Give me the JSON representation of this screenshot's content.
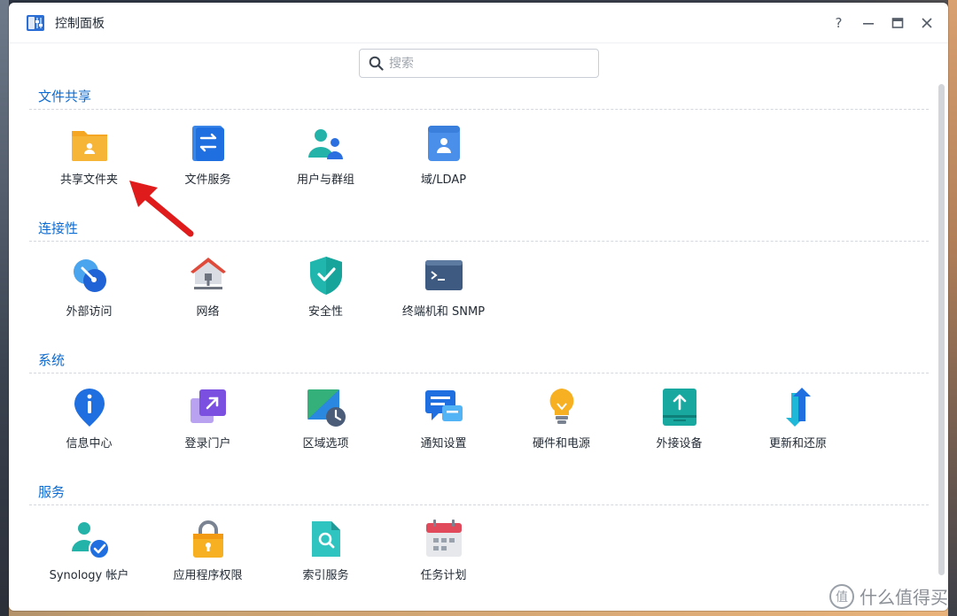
{
  "window": {
    "title": "控制面板",
    "help": "?",
    "minimize": "—",
    "maximize": "▭",
    "close": "✕"
  },
  "search": {
    "placeholder": "搜索"
  },
  "sections": [
    {
      "title": "文件共享",
      "items": [
        {
          "label": "共享文件夹",
          "icon": "shared-folder-icon"
        },
        {
          "label": "文件服务",
          "icon": "file-services-icon"
        },
        {
          "label": "用户与群组",
          "icon": "users-groups-icon"
        },
        {
          "label": "域/LDAP",
          "icon": "domain-ldap-icon"
        }
      ]
    },
    {
      "title": "连接性",
      "items": [
        {
          "label": "外部访问",
          "icon": "external-access-icon"
        },
        {
          "label": "网络",
          "icon": "network-icon"
        },
        {
          "label": "安全性",
          "icon": "security-shield-icon"
        },
        {
          "label": "终端机和 SNMP",
          "icon": "terminal-icon"
        }
      ]
    },
    {
      "title": "系统",
      "items": [
        {
          "label": "信息中心",
          "icon": "info-center-icon"
        },
        {
          "label": "登录门户",
          "icon": "login-portal-icon"
        },
        {
          "label": "区域选项",
          "icon": "regional-options-icon"
        },
        {
          "label": "通知设置",
          "icon": "notification-icon"
        },
        {
          "label": "硬件和电源",
          "icon": "hardware-power-icon"
        },
        {
          "label": "外接设备",
          "icon": "external-devices-icon"
        },
        {
          "label": "更新和还原",
          "icon": "update-restore-icon"
        }
      ]
    },
    {
      "title": "服务",
      "items": [
        {
          "label": "Synology 帐户",
          "icon": "synology-account-icon"
        },
        {
          "label": "应用程序权限",
          "icon": "app-privileges-lock-icon"
        },
        {
          "label": "索引服务",
          "icon": "indexing-service-icon"
        },
        {
          "label": "任务计划",
          "icon": "task-scheduler-icon"
        }
      ]
    }
  ],
  "watermark": {
    "text": "什么值得买",
    "badge": "值"
  },
  "colors": {
    "section_title": "#0d6bd1",
    "annotation_arrow": "#e01b1b"
  }
}
